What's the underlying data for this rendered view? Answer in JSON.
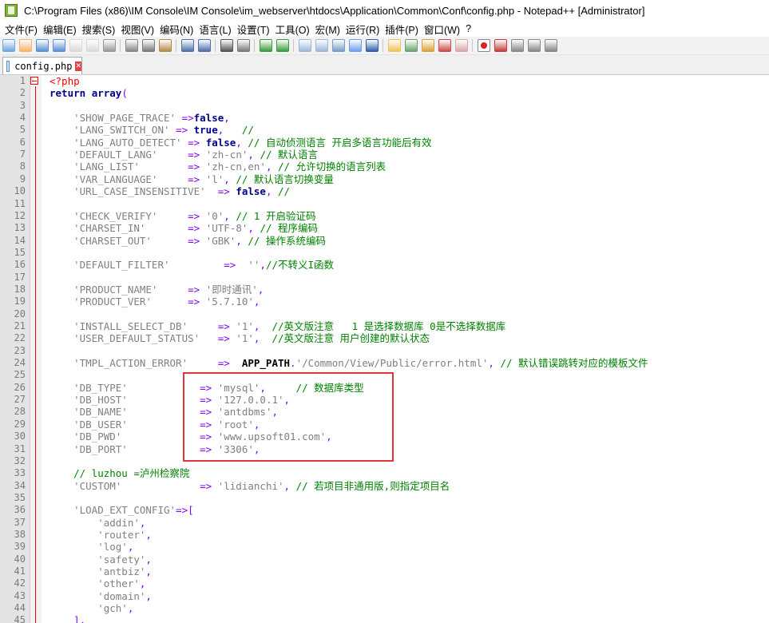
{
  "window": {
    "title": "C:\\Program Files (x86)\\IM Console\\IM Console\\im_webserver\\htdocs\\Application\\Common\\Conf\\config.php - Notepad++ [Administrator]"
  },
  "menu": [
    "文件(F)",
    "编辑(E)",
    "搜索(S)",
    "视图(V)",
    "编码(N)",
    "语言(L)",
    "设置(T)",
    "工具(O)",
    "宏(M)",
    "运行(R)",
    "插件(P)",
    "窗口(W)",
    "?"
  ],
  "tab": {
    "label": "config.php",
    "close": "✕"
  },
  "colors": {
    "highlight_box": "#e0353d",
    "keyword": "#00008b",
    "string": "#808080",
    "operator": "#8000ff",
    "comment": "#008000",
    "php_tag": "#ff0000"
  },
  "lines": [
    {
      "n": "1",
      "tokens": [
        {
          "t": "<?php",
          "c": "php"
        }
      ]
    },
    {
      "n": "2",
      "tokens": [
        {
          "t": "return ",
          "c": "kw"
        },
        {
          "t": "array",
          "c": "kw"
        },
        {
          "t": "(",
          "c": "op"
        }
      ]
    },
    {
      "n": "3",
      "tokens": []
    },
    {
      "n": "4",
      "tokens": [
        {
          "t": "    'SHOW_PAGE_TRACE'",
          "c": "str"
        },
        {
          "t": " =>",
          "c": "op"
        },
        {
          "t": "false",
          "c": "kw"
        },
        {
          "t": ",",
          "c": "op"
        }
      ]
    },
    {
      "n": "5",
      "tokens": [
        {
          "t": "    'LANG_SWITCH_ON'",
          "c": "str"
        },
        {
          "t": " => ",
          "c": "op"
        },
        {
          "t": "true",
          "c": "kw"
        },
        {
          "t": ",   ",
          "c": "op"
        },
        {
          "t": "//",
          "c": "cm"
        }
      ]
    },
    {
      "n": "6",
      "tokens": [
        {
          "t": "    'LANG_AUTO_DETECT'",
          "c": "str"
        },
        {
          "t": " => ",
          "c": "op"
        },
        {
          "t": "false",
          "c": "kw"
        },
        {
          "t": ", ",
          "c": "op"
        },
        {
          "t": "// 自动侦测语言 开启多语言功能后有效",
          "c": "cm"
        }
      ]
    },
    {
      "n": "7",
      "tokens": [
        {
          "t": "    'DEFAULT_LANG'",
          "c": "str"
        },
        {
          "t": "     => ",
          "c": "op"
        },
        {
          "t": "'zh-cn'",
          "c": "str"
        },
        {
          "t": ", ",
          "c": "op"
        },
        {
          "t": "// 默认语言",
          "c": "cm"
        }
      ]
    },
    {
      "n": "8",
      "tokens": [
        {
          "t": "    'LANG_LIST'",
          "c": "str"
        },
        {
          "t": "        => ",
          "c": "op"
        },
        {
          "t": "'zh-cn,en'",
          "c": "str"
        },
        {
          "t": ", ",
          "c": "op"
        },
        {
          "t": "// 允许切换的语言列表",
          "c": "cm"
        }
      ]
    },
    {
      "n": "9",
      "tokens": [
        {
          "t": "    'VAR_LANGUAGE'",
          "c": "str"
        },
        {
          "t": "     => ",
          "c": "op"
        },
        {
          "t": "'l'",
          "c": "str"
        },
        {
          "t": ", ",
          "c": "op"
        },
        {
          "t": "// 默认语言切换变量",
          "c": "cm"
        }
      ]
    },
    {
      "n": "10",
      "tokens": [
        {
          "t": "    'URL_CASE_INSENSITIVE'",
          "c": "str"
        },
        {
          "t": "  => ",
          "c": "op"
        },
        {
          "t": "false",
          "c": "kw"
        },
        {
          "t": ", ",
          "c": "op"
        },
        {
          "t": "//",
          "c": "cm"
        }
      ]
    },
    {
      "n": "11",
      "tokens": []
    },
    {
      "n": "12",
      "tokens": [
        {
          "t": "    'CHECK_VERIFY'",
          "c": "str"
        },
        {
          "t": "     => ",
          "c": "op"
        },
        {
          "t": "'0'",
          "c": "str"
        },
        {
          "t": ", ",
          "c": "op"
        },
        {
          "t": "// 1 开启验证码",
          "c": "cm"
        }
      ]
    },
    {
      "n": "13",
      "tokens": [
        {
          "t": "    'CHARSET_IN'",
          "c": "str"
        },
        {
          "t": "       => ",
          "c": "op"
        },
        {
          "t": "'UTF-8'",
          "c": "str"
        },
        {
          "t": ", ",
          "c": "op"
        },
        {
          "t": "// 程序编码",
          "c": "cm"
        }
      ]
    },
    {
      "n": "14",
      "tokens": [
        {
          "t": "    'CHARSET_OUT'",
          "c": "str"
        },
        {
          "t": "      => ",
          "c": "op"
        },
        {
          "t": "'GBK'",
          "c": "str"
        },
        {
          "t": ", ",
          "c": "op"
        },
        {
          "t": "// 操作系统编码",
          "c": "cm"
        }
      ]
    },
    {
      "n": "15",
      "tokens": []
    },
    {
      "n": "16",
      "tokens": [
        {
          "t": "    'DEFAULT_FILTER'",
          "c": "str"
        },
        {
          "t": "         =>  ",
          "c": "op"
        },
        {
          "t": "''",
          "c": "str"
        },
        {
          "t": ",",
          "c": "op"
        },
        {
          "t": "//不转义I函数",
          "c": "cm"
        }
      ]
    },
    {
      "n": "17",
      "tokens": []
    },
    {
      "n": "18",
      "tokens": [
        {
          "t": "    'PRODUCT_NAME'",
          "c": "str"
        },
        {
          "t": "     => ",
          "c": "op"
        },
        {
          "t": "'即时通讯'",
          "c": "str"
        },
        {
          "t": ",",
          "c": "op"
        }
      ]
    },
    {
      "n": "19",
      "tokens": [
        {
          "t": "    'PRODUCT_VER'",
          "c": "str"
        },
        {
          "t": "      => ",
          "c": "op"
        },
        {
          "t": "'5.7.10'",
          "c": "str"
        },
        {
          "t": ",",
          "c": "op"
        }
      ]
    },
    {
      "n": "20",
      "tokens": []
    },
    {
      "n": "21",
      "tokens": [
        {
          "t": "    'INSTALL_SELECT_DB'",
          "c": "str"
        },
        {
          "t": "     => ",
          "c": "op"
        },
        {
          "t": "'1'",
          "c": "str"
        },
        {
          "t": ",  ",
          "c": "op"
        },
        {
          "t": "//英文版注意   1 是选择数据库 0是不选择数据库",
          "c": "cm"
        }
      ]
    },
    {
      "n": "22",
      "tokens": [
        {
          "t": "    'USER_DEFAULT_STATUS'",
          "c": "str"
        },
        {
          "t": "   => ",
          "c": "op"
        },
        {
          "t": "'1'",
          "c": "str"
        },
        {
          "t": ",  ",
          "c": "op"
        },
        {
          "t": "//英文版注意 用户创建的默认状态",
          "c": "cm"
        }
      ]
    },
    {
      "n": "23",
      "tokens": []
    },
    {
      "n": "24",
      "tokens": [
        {
          "t": "    'TMPL_ACTION_ERROR'",
          "c": "str"
        },
        {
          "t": "     =>  ",
          "c": "op"
        },
        {
          "t": "APP_PATH",
          "c": "fn"
        },
        {
          "t": ".",
          "c": "op"
        },
        {
          "t": "'/Common/View/Public/error.html'",
          "c": "str"
        },
        {
          "t": ", ",
          "c": "op"
        },
        {
          "t": "// 默认错误跳转对应的模板文件",
          "c": "cm"
        }
      ]
    },
    {
      "n": "25",
      "tokens": []
    },
    {
      "n": "26",
      "tokens": [
        {
          "t": "    'DB_TYPE'",
          "c": "str"
        },
        {
          "t": "            => ",
          "c": "op"
        },
        {
          "t": "'mysql'",
          "c": "str"
        },
        {
          "t": ",     ",
          "c": "op"
        },
        {
          "t": "// 数据库类型",
          "c": "cm"
        }
      ]
    },
    {
      "n": "27",
      "tokens": [
        {
          "t": "    'DB_HOST'",
          "c": "str"
        },
        {
          "t": "            => ",
          "c": "op"
        },
        {
          "t": "'127.0.0.1'",
          "c": "str"
        },
        {
          "t": ",",
          "c": "op"
        }
      ]
    },
    {
      "n": "28",
      "tokens": [
        {
          "t": "    'DB_NAME'",
          "c": "str"
        },
        {
          "t": "            => ",
          "c": "op"
        },
        {
          "t": "'antdbms'",
          "c": "str"
        },
        {
          "t": ",",
          "c": "op"
        }
      ]
    },
    {
      "n": "29",
      "tokens": [
        {
          "t": "    'DB_USER'",
          "c": "str"
        },
        {
          "t": "            => ",
          "c": "op"
        },
        {
          "t": "'root'",
          "c": "str"
        },
        {
          "t": ",",
          "c": "op"
        }
      ]
    },
    {
      "n": "30",
      "tokens": [
        {
          "t": "    'DB_PWD'",
          "c": "str"
        },
        {
          "t": "             => ",
          "c": "op"
        },
        {
          "t": "'www.upsoft01.com'",
          "c": "str"
        },
        {
          "t": ",",
          "c": "op"
        }
      ]
    },
    {
      "n": "31",
      "tokens": [
        {
          "t": "    'DB_PORT'",
          "c": "str"
        },
        {
          "t": "            => ",
          "c": "op"
        },
        {
          "t": "'3306'",
          "c": "str"
        },
        {
          "t": ",",
          "c": "op"
        }
      ]
    },
    {
      "n": "32",
      "tokens": []
    },
    {
      "n": "33",
      "tokens": [
        {
          "t": "    // luzhou =泸州检察院",
          "c": "cm"
        }
      ]
    },
    {
      "n": "34",
      "tokens": [
        {
          "t": "    'CUSTOM'",
          "c": "str"
        },
        {
          "t": "             => ",
          "c": "op"
        },
        {
          "t": "'lidianchi'",
          "c": "str"
        },
        {
          "t": ", ",
          "c": "op"
        },
        {
          "t": "// 若项目非通用版,则指定项目名",
          "c": "cm"
        }
      ]
    },
    {
      "n": "35",
      "tokens": []
    },
    {
      "n": "36",
      "tokens": [
        {
          "t": "    'LOAD_EXT_CONFIG'",
          "c": "str"
        },
        {
          "t": "=>[",
          "c": "op"
        }
      ]
    },
    {
      "n": "37",
      "tokens": [
        {
          "t": "        'addin'",
          "c": "str"
        },
        {
          "t": ",",
          "c": "op"
        }
      ]
    },
    {
      "n": "38",
      "tokens": [
        {
          "t": "        'router'",
          "c": "str"
        },
        {
          "t": ",",
          "c": "op"
        }
      ]
    },
    {
      "n": "39",
      "tokens": [
        {
          "t": "        'log'",
          "c": "str"
        },
        {
          "t": ",",
          "c": "op"
        }
      ]
    },
    {
      "n": "40",
      "tokens": [
        {
          "t": "        'safety'",
          "c": "str"
        },
        {
          "t": ",",
          "c": "op"
        }
      ]
    },
    {
      "n": "41",
      "tokens": [
        {
          "t": "        'antbiz'",
          "c": "str"
        },
        {
          "t": ",",
          "c": "op"
        }
      ]
    },
    {
      "n": "42",
      "tokens": [
        {
          "t": "        'other'",
          "c": "str"
        },
        {
          "t": ",",
          "c": "op"
        }
      ]
    },
    {
      "n": "43",
      "tokens": [
        {
          "t": "        'domain'",
          "c": "str"
        },
        {
          "t": ",",
          "c": "op"
        }
      ]
    },
    {
      "n": "44",
      "tokens": [
        {
          "t": "        'gch'",
          "c": "str"
        },
        {
          "t": ",",
          "c": "op"
        }
      ]
    },
    {
      "n": "45",
      "tokens": [
        {
          "t": "    ],",
          "c": "op"
        }
      ]
    }
  ],
  "toolbar_icons": [
    "new-file-icon",
    "open-file-icon",
    "save-icon",
    "save-all-icon",
    "close-icon",
    "close-all-icon",
    "print-icon",
    "cut-icon",
    "copy-icon",
    "paste-icon",
    "undo-icon",
    "redo-icon",
    "find-icon",
    "replace-icon",
    "zoom-in-icon",
    "zoom-out-icon",
    "sync-vertical-icon",
    "sync-horizontal-icon",
    "word-wrap-icon",
    "show-all-chars-icon",
    "indent-guide-icon",
    "doc-map-icon",
    "function-list-icon",
    "folder-workspace-icon",
    "user-lang-icon",
    "monitor-icon",
    "record-macro-icon",
    "stop-macro-icon",
    "play-macro-icon",
    "run-macro-multiple-icon",
    "save-macro-icon"
  ]
}
